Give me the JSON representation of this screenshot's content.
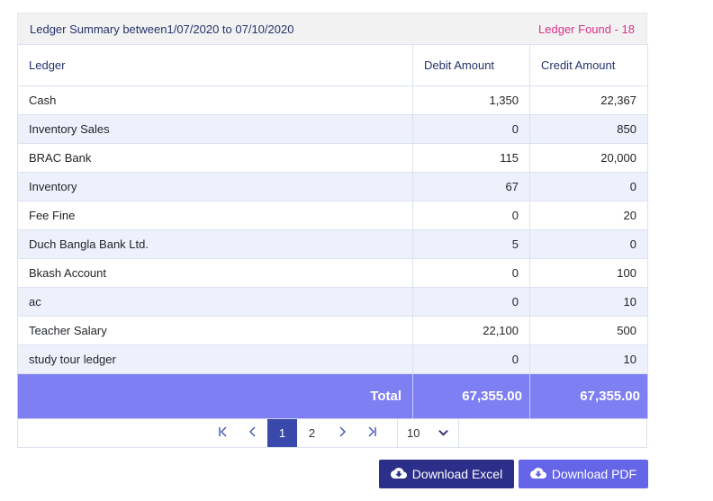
{
  "header": {
    "title": "Ledger Summary between1/07/2020 to 07/10/2020",
    "found": "Ledger Found - 18"
  },
  "table": {
    "columns": [
      "Ledger",
      "Debit Amount",
      "Credit Amount"
    ],
    "rows": [
      {
        "ledger": "Cash",
        "debit": "1,350",
        "credit": "22,367"
      },
      {
        "ledger": "Inventory Sales",
        "debit": "0",
        "credit": "850"
      },
      {
        "ledger": "BRAC Bank",
        "debit": "115",
        "credit": "20,000"
      },
      {
        "ledger": "Inventory",
        "debit": "67",
        "credit": "0"
      },
      {
        "ledger": "Fee Fine",
        "debit": "0",
        "credit": "20"
      },
      {
        "ledger": "Duch Bangla Bank Ltd.",
        "debit": "5",
        "credit": "0"
      },
      {
        "ledger": "Bkash Account",
        "debit": "0",
        "credit": "100"
      },
      {
        "ledger": "ac",
        "debit": "0",
        "credit": "10"
      },
      {
        "ledger": "Teacher Salary",
        "debit": "22,100",
        "credit": "500"
      },
      {
        "ledger": "study tour ledger",
        "debit": "0",
        "credit": "10"
      }
    ],
    "total_label": "Total",
    "total_debit": "67,355.00",
    "total_credit": "67,355.00"
  },
  "pagination": {
    "pages": [
      "1",
      "2"
    ],
    "current_page": "1",
    "page_size": "10",
    "icons": [
      "first-page-icon",
      "prev-page-icon",
      "next-page-icon",
      "last-page-icon",
      "chevron-down-icon"
    ]
  },
  "actions": {
    "excel_label": "Download Excel",
    "pdf_label": "Download PDF",
    "excel_color": "#2c2f8a",
    "pdf_color": "#6565e8",
    "icon": "cloud-download-icon"
  },
  "colors": {
    "found_badge": "#d6338a",
    "total_row": "#7f7ff4",
    "active_page": "#3949ab"
  }
}
